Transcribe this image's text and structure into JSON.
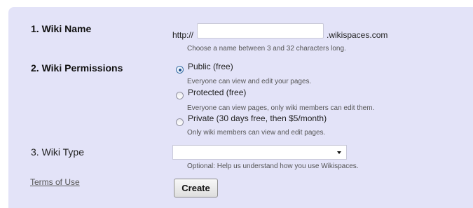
{
  "wiki_name": {
    "label": "1. Wiki Name",
    "prefix": "http://",
    "value": "",
    "suffix": ".wikispaces.com",
    "hint": "Choose a name between 3 and 32 characters long."
  },
  "permissions": {
    "label": "2. Wiki Permissions",
    "options": [
      {
        "label": "Public (free)",
        "description": "Everyone can view and edit your pages.",
        "selected": true
      },
      {
        "label": "Protected (free)",
        "description": "Everyone can view pages, only wiki members can edit them.",
        "selected": false
      },
      {
        "label": "Private (30 days free, then $5/month)",
        "description": "Only wiki members can view and edit pages.",
        "selected": false
      }
    ]
  },
  "wiki_type": {
    "label": "3. Wiki Type",
    "selected_value": "",
    "hint": "Optional: Help us understand how you use Wikispaces."
  },
  "terms_link": "Terms of Use",
  "create_button": "Create"
}
